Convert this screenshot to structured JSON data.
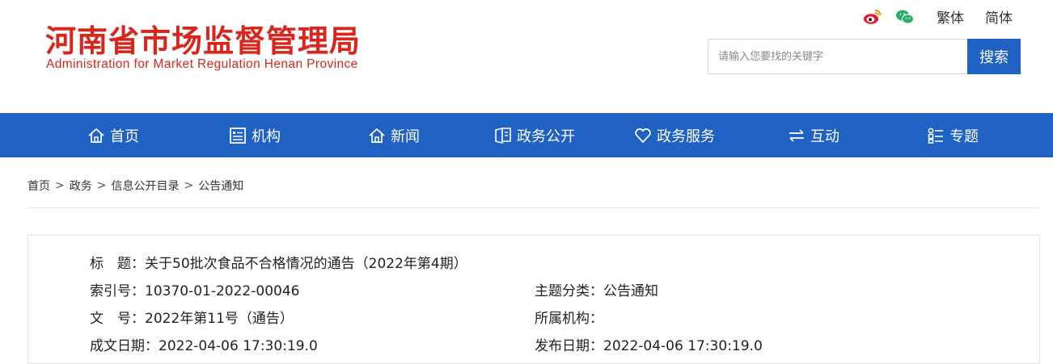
{
  "header": {
    "title": "河南省市场监督管理局",
    "subtitle": "Administration for Market Regulation Henan Province",
    "brand_color": "#d9261c",
    "top_links": {
      "weibo_icon": "weibo-icon",
      "wechat_icon": "wechat-icon",
      "traditional": "繁体",
      "simplified": "简体"
    },
    "search": {
      "placeholder": "请输入您要找的关键字",
      "button": "搜索"
    }
  },
  "nav": {
    "color": "#2062c4",
    "items": [
      {
        "label": "首页",
        "icon": "home-icon"
      },
      {
        "label": "机构",
        "icon": "list-icon"
      },
      {
        "label": "新闻",
        "icon": "home-icon"
      },
      {
        "label": "政务公开",
        "icon": "book-icon"
      },
      {
        "label": "政务服务",
        "icon": "heart-icon"
      },
      {
        "label": "互动",
        "icon": "exchange-icon"
      },
      {
        "label": "专题",
        "icon": "grid-list-icon"
      }
    ]
  },
  "breadcrumb": [
    "首页",
    "政务",
    "信息公开目录",
    "公告通知"
  ],
  "info": {
    "title_label": "标　题：",
    "title_value": "关于50批次食品不合格情况的通告（2022年第4期）",
    "index_label": "索引号：",
    "index_value": "10370-01-2022-00046",
    "topic_label": "主题分类：",
    "topic_value": "公告通知",
    "doc_label": "文　号：",
    "doc_value": "2022年第11号（通告）",
    "org_label": "所属机构：",
    "org_value": "",
    "created_label": "成文日期：",
    "created_value": "2022-04-06 17:30:19.0",
    "published_label": "发布日期：",
    "published_value": "2022-04-06 17:30:19.0"
  }
}
